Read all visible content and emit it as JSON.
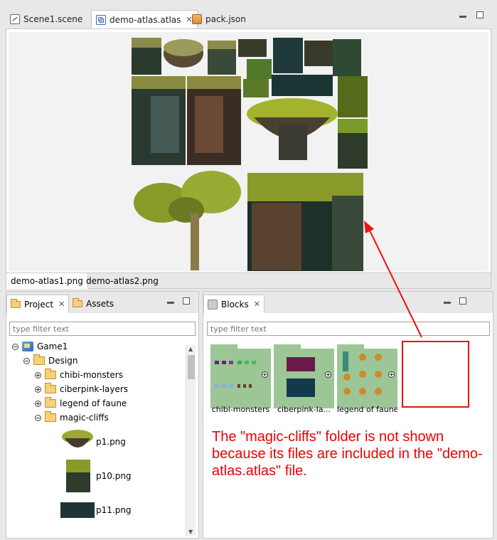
{
  "editor": {
    "tabs": [
      {
        "label": "Scene1.scene",
        "icon": "scene-file-icon"
      },
      {
        "label": "demo-atlas.atlas",
        "icon": "atlas-file-icon",
        "active": true
      },
      {
        "label": "pack.json",
        "icon": "json-file-icon"
      }
    ],
    "page_tabs": [
      "demo-atlas1.png",
      "demo-atlas2.png"
    ]
  },
  "project_panel": {
    "tabs": [
      "Project",
      "Assets"
    ],
    "filter_placeholder": "type filter text",
    "tree": [
      {
        "label": "Game1",
        "level": 0,
        "expanded": true,
        "icon": "project-icon"
      },
      {
        "label": "Design",
        "level": 1,
        "expanded": true,
        "icon": "folder-icon"
      },
      {
        "label": "chibi-monsters",
        "level": 2,
        "expanded": false,
        "icon": "folder-icon"
      },
      {
        "label": "ciberpink-layers",
        "level": 2,
        "expanded": false,
        "icon": "folder-icon"
      },
      {
        "label": "legend of faune",
        "level": 2,
        "expanded": false,
        "icon": "folder-icon"
      },
      {
        "label": "magic-cliffs",
        "level": 2,
        "expanded": true,
        "icon": "folder-icon"
      }
    ],
    "files": [
      "p1.png",
      "p10.png",
      "p11.png"
    ]
  },
  "blocks_panel": {
    "tab": "Blocks",
    "filter_placeholder": "type filter text",
    "blocks": [
      "chibi-monsters",
      "ciberpink-la...",
      "legend of faune"
    ]
  },
  "annotation": "The \"magic-cliffs\" folder is not shown because its files are included in the \"demo-atlas.atlas\" file.",
  "colors": {
    "annotation": "#ee0000",
    "block_bg": "#9cc695"
  }
}
